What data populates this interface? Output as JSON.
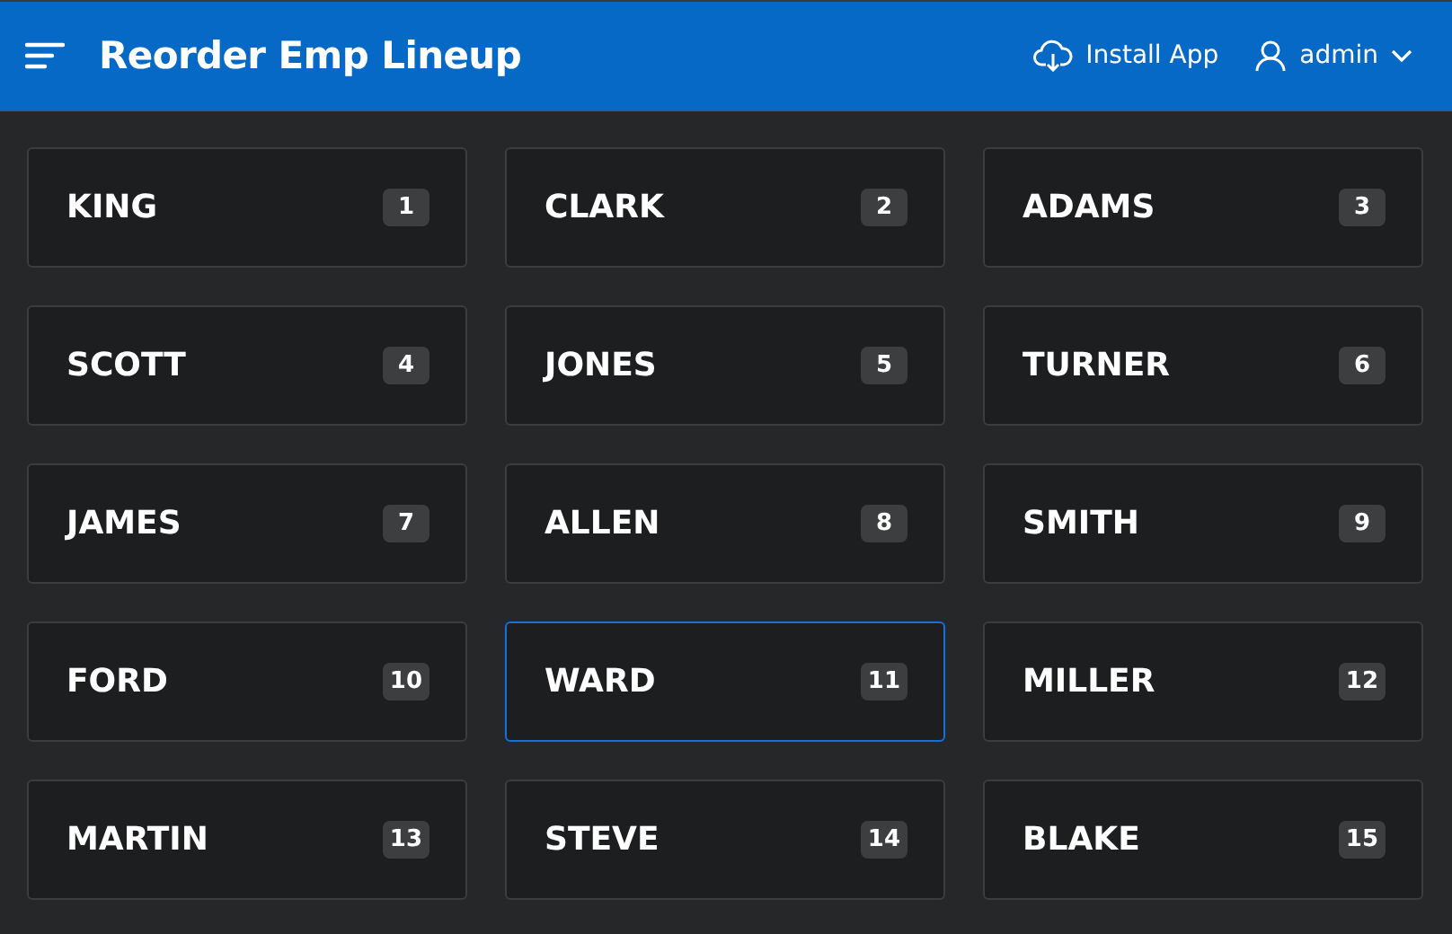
{
  "header": {
    "title": "Reorder Emp Lineup",
    "install_label": "Install App",
    "user": "admin"
  },
  "cards": [
    {
      "name": "KING",
      "number": "1",
      "selected": false
    },
    {
      "name": "CLARK",
      "number": "2",
      "selected": false
    },
    {
      "name": "ADAMS",
      "number": "3",
      "selected": false
    },
    {
      "name": "SCOTT",
      "number": "4",
      "selected": false
    },
    {
      "name": "JONES",
      "number": "5",
      "selected": false
    },
    {
      "name": "TURNER",
      "number": "6",
      "selected": false
    },
    {
      "name": "JAMES",
      "number": "7",
      "selected": false
    },
    {
      "name": "ALLEN",
      "number": "8",
      "selected": false
    },
    {
      "name": "SMITH",
      "number": "9",
      "selected": false
    },
    {
      "name": "FORD",
      "number": "10",
      "selected": false
    },
    {
      "name": "WARD",
      "number": "11",
      "selected": true
    },
    {
      "name": "MILLER",
      "number": "12",
      "selected": false
    },
    {
      "name": "MARTIN",
      "number": "13",
      "selected": false
    },
    {
      "name": "STEVE",
      "number": "14",
      "selected": false
    },
    {
      "name": "BLAKE",
      "number": "15",
      "selected": false
    }
  ]
}
